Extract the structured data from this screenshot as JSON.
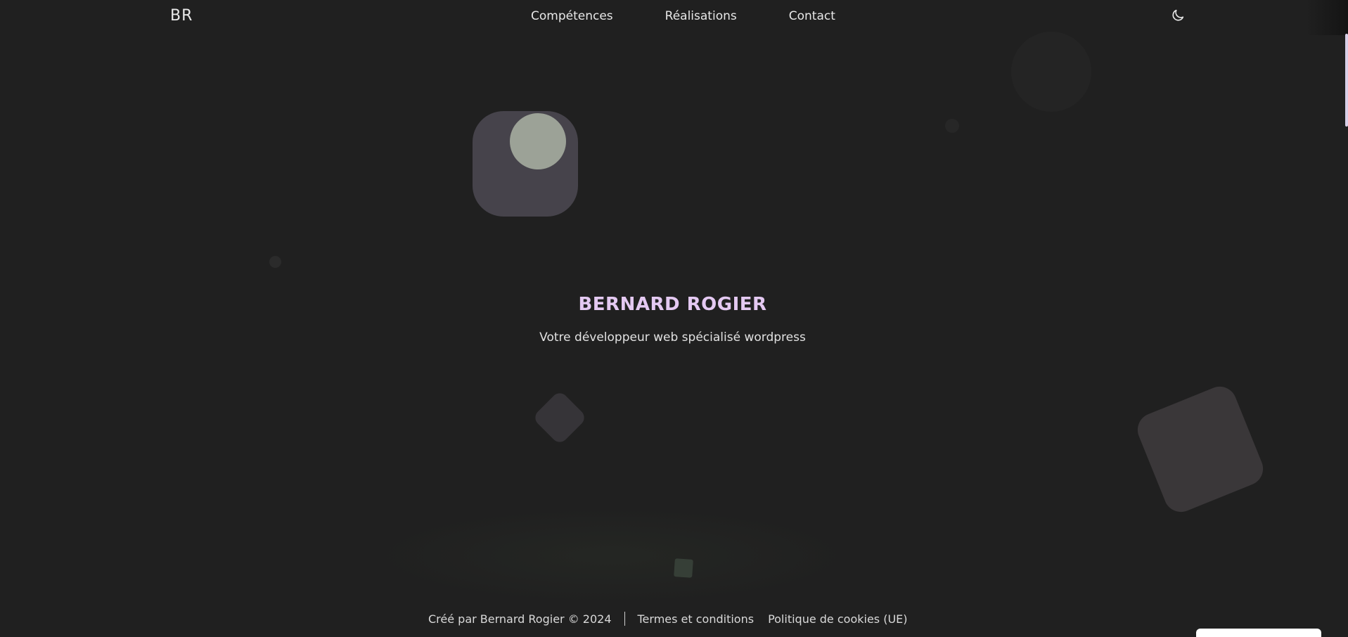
{
  "header": {
    "logo": "BR",
    "nav": [
      "Compétences",
      "Réalisations",
      "Contact"
    ],
    "theme_toggle_icon": "moon-icon"
  },
  "hero": {
    "title": "BERNARD ROGIER",
    "subtitle": "Votre développeur web spécialisé wordpress"
  },
  "footer": {
    "credit": "Créé par Bernard Rogier © 2024",
    "links": [
      "Termes et conditions",
      "Politique de cookies (UE)"
    ]
  },
  "colors": {
    "background": "#202020",
    "accent_title": "#e4c9f2",
    "text": "#e6e6e6"
  }
}
